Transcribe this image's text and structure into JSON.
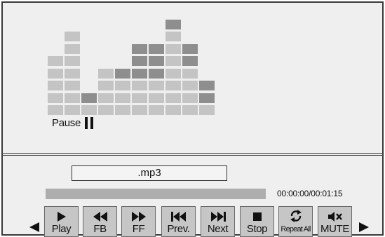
{
  "player": {
    "status_label": "Pause",
    "file_name": ".mp3",
    "time_readout": "00:00:00/00:01:15",
    "progress_fraction": 1.0
  },
  "equalizer": {
    "columns": [
      {
        "light": 5,
        "dark": 0
      },
      {
        "light": 7,
        "dark": 0
      },
      {
        "light": 1,
        "dark": 1
      },
      {
        "light": 4,
        "dark": 0
      },
      {
        "light": 3,
        "dark": 1
      },
      {
        "light": 3,
        "dark": 3
      },
      {
        "light": 3,
        "dark": 3
      },
      {
        "light": 7,
        "dark": 1
      },
      {
        "light": 4,
        "dark": 2
      },
      {
        "light": 1,
        "dark": 2
      }
    ],
    "colors": {
      "light": "#c4c4c4",
      "dark": "#8e8e8e"
    }
  },
  "controls": {
    "buttons": [
      {
        "label": "Play",
        "icon": "play-icon"
      },
      {
        "label": "FB",
        "icon": "fast-backward-icon"
      },
      {
        "label": "FF",
        "icon": "fast-forward-icon"
      },
      {
        "label": "Prev.",
        "icon": "previous-track-icon"
      },
      {
        "label": "Next",
        "icon": "next-track-icon"
      },
      {
        "label": "Stop",
        "icon": "stop-icon"
      },
      {
        "label": "Repeat All",
        "icon": "repeat-icon"
      },
      {
        "label": "MUTE",
        "icon": "mute-icon"
      }
    ],
    "scroll_left_icon": "left-arrow-icon",
    "scroll_right_icon": "right-arrow-icon"
  }
}
